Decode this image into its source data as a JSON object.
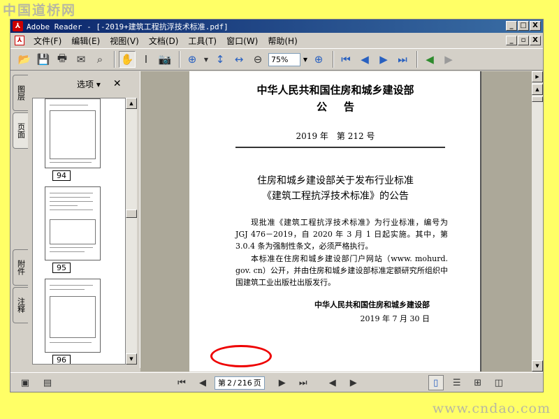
{
  "watermark": {
    "top": "中国道桥网",
    "bottom": "www.cndao.com"
  },
  "window": {
    "title": "Adobe Reader - [-2019+建筑工程抗浮技术标准.pdf]",
    "app_icon": "adobe-reader-icon",
    "title_buttons": [
      "_",
      "□",
      "X"
    ],
    "doc_buttons": [
      "_",
      "▫",
      "X"
    ]
  },
  "menu": [
    {
      "label": "文件(F)"
    },
    {
      "label": "编辑(E)"
    },
    {
      "label": "视图(V)"
    },
    {
      "label": "文档(D)"
    },
    {
      "label": "工具(T)"
    },
    {
      "label": "窗口(W)"
    },
    {
      "label": "帮助(H)"
    }
  ],
  "toolbar": {
    "zoom_value": "75%"
  },
  "sidebar": {
    "tabs": [
      "图层",
      "页面",
      "附件",
      "注释"
    ],
    "options_label": "选项 ▾",
    "close_label": "✕",
    "thumbnails": [
      {
        "label": "94"
      },
      {
        "label": "95"
      },
      {
        "label": "96"
      }
    ]
  },
  "document": {
    "org_title": "中华人民共和国住房和城乡建设部",
    "doc_type": "公告",
    "doc_number": "2019 年　第 212 号",
    "heading_line1": "住房和城乡建设部关于发布行业标准",
    "heading_line2": "《建筑工程抗浮技术标准》的公告",
    "body_para1": "现批准《建筑工程抗浮技术标准》为行业标准，编号为 JGJ 476－2019，自 2020 年 3 月 1 日起实施。其中，第 3.0.4 条为强制性条文，必须严格执行。",
    "body_para2": "本标准在住房和城乡建设部门户网站（www. mohurd. gov. cn）公开，并由住房和城乡建设部标准定额研究所组织中国建筑工业出版社出版发行。",
    "signature_org": "中华人民共和国住房和城乡建设部",
    "signature_date": "2019 年 7 月 30 日"
  },
  "statusbar": {
    "page_prefix": "第",
    "current_page": "2",
    "separator": "/",
    "total_pages": "216",
    "page_suffix": "页"
  },
  "colors": {
    "titlebar_start": "#0a246a",
    "titlebar_end": "#3a6ea5",
    "background": "#ffff66",
    "highlight_ellipse": "#e00000"
  }
}
